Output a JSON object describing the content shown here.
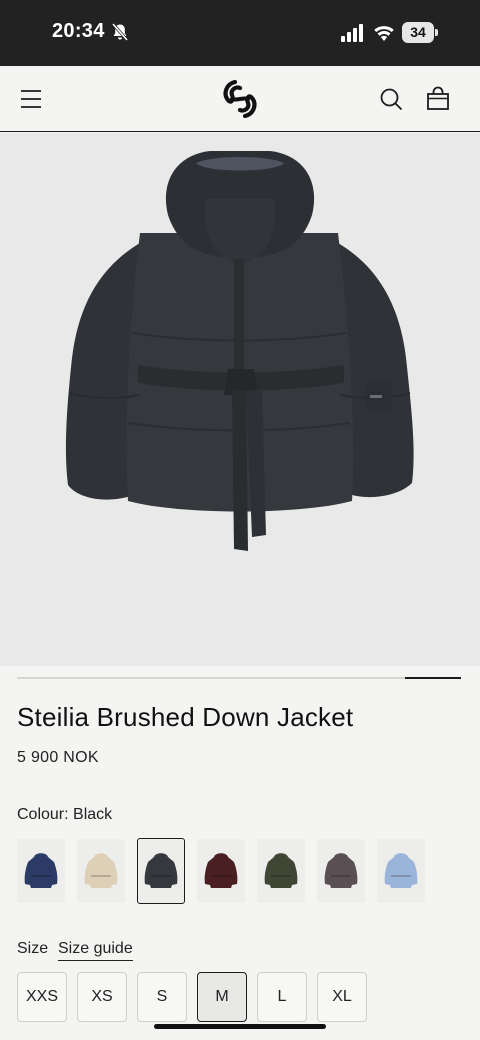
{
  "status_bar": {
    "time": "20:34",
    "battery": "34",
    "icons": [
      "bell-slash-icon",
      "cellular-signal-icon",
      "wifi-icon",
      "battery-icon"
    ]
  },
  "nav": {
    "icons": [
      "menu-icon",
      "brand-logo",
      "search-icon",
      "shopping-bag-icon"
    ]
  },
  "product": {
    "name": "Steilia Brushed Down Jacket",
    "price": "5 900 NOK",
    "image_icon": "jacket-photo",
    "gallery_progress": 0.125
  },
  "colour": {
    "label": "Colour: Black",
    "selected": "Black",
    "swatches": [
      {
        "color": "#2c3a66",
        "selected": false
      },
      {
        "color": "#ddd0b6",
        "selected": false
      },
      {
        "color": "#35383d",
        "selected": true
      },
      {
        "color": "#4a1f22",
        "selected": false
      },
      {
        "color": "#3f4634",
        "selected": false
      },
      {
        "color": "#5a5053",
        "selected": false
      },
      {
        "color": "#9bb5da",
        "selected": false
      }
    ]
  },
  "size": {
    "label": "Size",
    "guide_label": "Size guide",
    "options": [
      "XXS",
      "XS",
      "S",
      "M",
      "L",
      "XL"
    ],
    "selected": "M"
  },
  "colors": {
    "status_bar_bg": "#222222",
    "page_bg": "#f4f4f2",
    "image_bg": "#e9e9e9",
    "accent": "#1c1c1c"
  }
}
